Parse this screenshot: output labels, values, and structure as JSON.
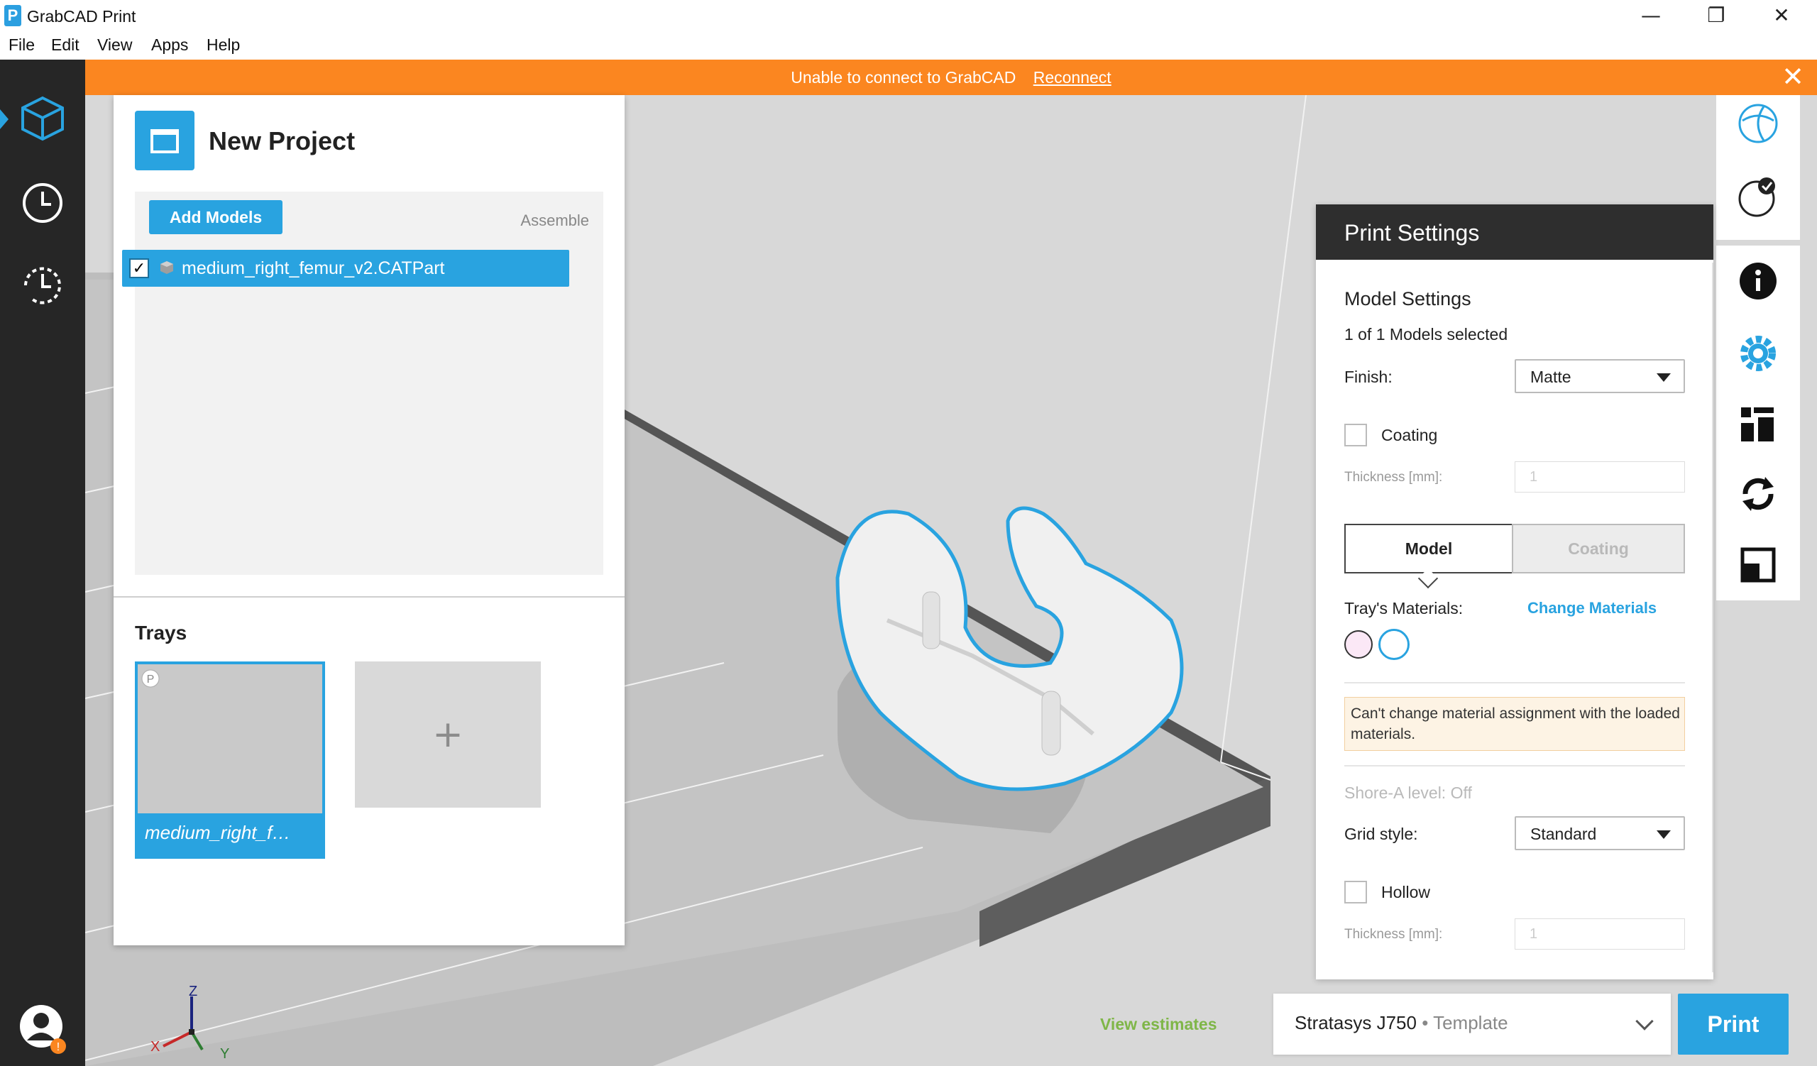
{
  "window": {
    "title": "GrabCAD Print",
    "minimize": "—",
    "restore": "❐",
    "close": "✕"
  },
  "menu": [
    "File",
    "Edit",
    "View",
    "Apps",
    "Help"
  ],
  "banner": {
    "message": "Unable to connect to GrabCAD",
    "action": "Reconnect",
    "close": "✕",
    "color": "#fb8620"
  },
  "sidebar": {
    "items": [
      {
        "icon": "cube-icon"
      },
      {
        "icon": "clock-icon"
      },
      {
        "icon": "history-icon"
      }
    ],
    "user_icon": "user-icon"
  },
  "project": {
    "title": "New Project",
    "add_models_label": "Add Models",
    "assemble_label": "Assemble",
    "models": [
      {
        "name": "medium_right_femur_v2.CATPart",
        "checked": true
      }
    ],
    "trays_title": "Trays",
    "trays": [
      {
        "name": "medium_right_f…"
      }
    ],
    "add_tray_label": "+"
  },
  "print_settings": {
    "title": "Print Settings",
    "section_title": "Model Settings",
    "selection_count": "1 of 1 Models selected",
    "finish_label": "Finish:",
    "finish_value": "Matte",
    "coating_label": "Coating",
    "thickness_label": "Thickness [mm]:",
    "thickness_placeholder": "1",
    "tabs": [
      "Model",
      "Coating"
    ],
    "trays_materials_label": "Tray's Materials:",
    "change_materials_label": "Change Materials",
    "warning": "Can't change material assignment with the loaded materials.",
    "shore_label": "Shore-A level: Off",
    "grid_style_label": "Grid style:",
    "grid_style_value": "Standard",
    "hollow_label": "Hollow",
    "hollow_thickness_label": "Thickness [mm]:",
    "hollow_thickness_placeholder": "1"
  },
  "footer": {
    "view_estimates": "View estimates",
    "printer_name": "Stratasys J750",
    "printer_separator": "•",
    "printer_mode": "Template",
    "print_label": "Print"
  },
  "axes": {
    "z": "Z",
    "x": "X",
    "y": "Y"
  },
  "colors": {
    "accent": "#29a3e0",
    "banner": "#fb8620",
    "sidebar": "#262626",
    "estimates": "#7fb648"
  }
}
